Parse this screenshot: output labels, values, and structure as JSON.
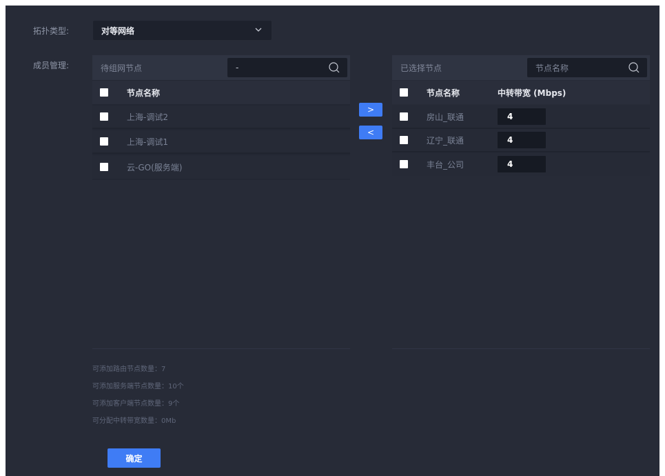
{
  "form": {
    "topology_label": "拓扑类型:",
    "topology_value": "对等网络",
    "member_label": "成员管理:"
  },
  "left_panel": {
    "title": "待组网节点",
    "search_value": "-",
    "column_name": "节点名称",
    "rows": [
      {
        "name": "上海-调试2"
      },
      {
        "name": "上海-调试1"
      },
      {
        "name": "云-GO(服务端)"
      }
    ]
  },
  "transfer": {
    "to_right": ">",
    "to_left": "<"
  },
  "right_panel": {
    "title": "已选择节点",
    "search_placeholder": "节点名称",
    "column_name": "节点名称",
    "column_bandwidth": "中转带宽 (Mbps)",
    "rows": [
      {
        "name": "房山_联通",
        "bandwidth": "4"
      },
      {
        "name": "辽宁_联通",
        "bandwidth": "4"
      },
      {
        "name": "丰台_公司",
        "bandwidth": "4"
      }
    ]
  },
  "stats": [
    "可添加路由节点数量：7",
    "可添加服务端节点数量：10个",
    "可添加客户端节点数量：9个",
    "可分配中转带宽数量：0Mb"
  ],
  "confirm_label": "确定",
  "colors": {
    "background": "#272b37",
    "accent": "#3f7cf5"
  }
}
